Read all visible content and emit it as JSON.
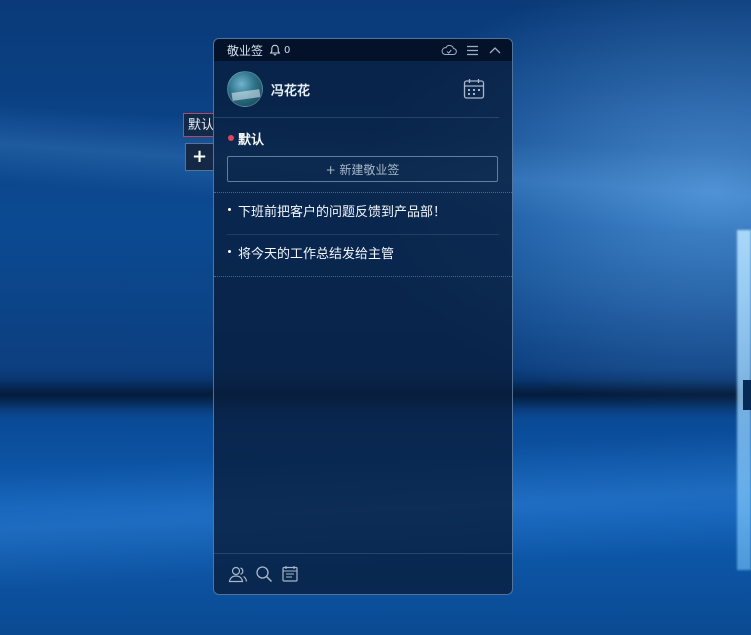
{
  "widget": {
    "app_title": "敬业签",
    "notification_count": "0",
    "user_name": "冯花花",
    "category_name": "默认",
    "new_note_label": "+ 新建敬业签",
    "notes": [
      {
        "text": "下班前把客户的问题反馈到产品部！"
      },
      {
        "text": "将今天的工作总结发给主管"
      }
    ]
  },
  "side_tabs": {
    "category_tab_label": "默认",
    "add_tab_label": "+"
  },
  "colors": {
    "category_dot": "#e0465e",
    "tab_accent": "#b54a5a"
  },
  "icons": {
    "titlebar": [
      "bell-icon",
      "cloud-sync-icon",
      "menu-icon",
      "collapse-icon"
    ],
    "profile": [
      "calendar-icon"
    ],
    "footer": [
      "contacts-icon",
      "search-icon",
      "notes-icon"
    ]
  }
}
